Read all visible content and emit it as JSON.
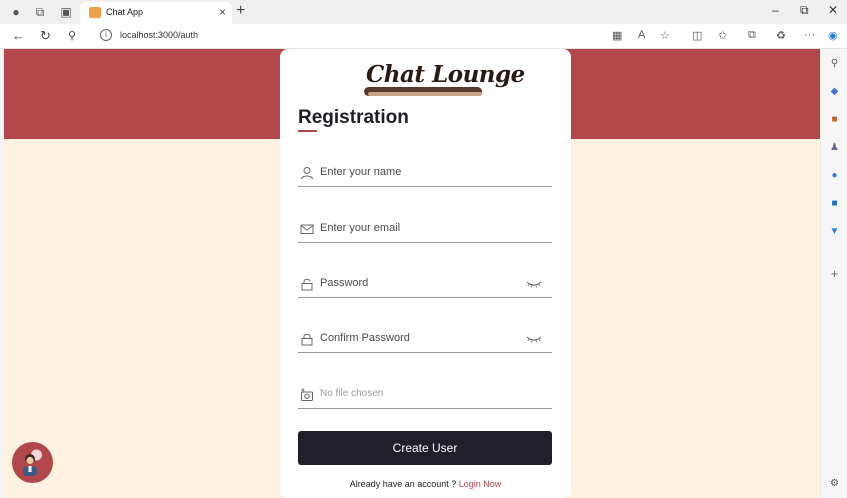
{
  "browser": {
    "tab_title": "Chat App",
    "url": "localhost:3000/auth"
  },
  "icons": {
    "profile": "profile-icon",
    "workspaces": "workspaces-icon",
    "tabs": "tab-actions-icon",
    "back": "back-arrow-icon",
    "refresh": "refresh-icon",
    "search": "search-icon",
    "info": "site-info-icon"
  },
  "page": {
    "logo_text": "Chat Lounge",
    "heading": "Registration",
    "fields": {
      "name_placeholder": "Enter your name",
      "email_placeholder": "Enter your email",
      "password_placeholder": "Password",
      "confirm_placeholder": "Confirm Password",
      "file_placeholder": "No file chosen"
    },
    "create_button": "Create User",
    "already_text": "Already have an account ?",
    "login_link": "Login Now"
  },
  "colors": {
    "brand": "#b1474b",
    "background": "#fff1e0",
    "button": "#201f2a"
  }
}
